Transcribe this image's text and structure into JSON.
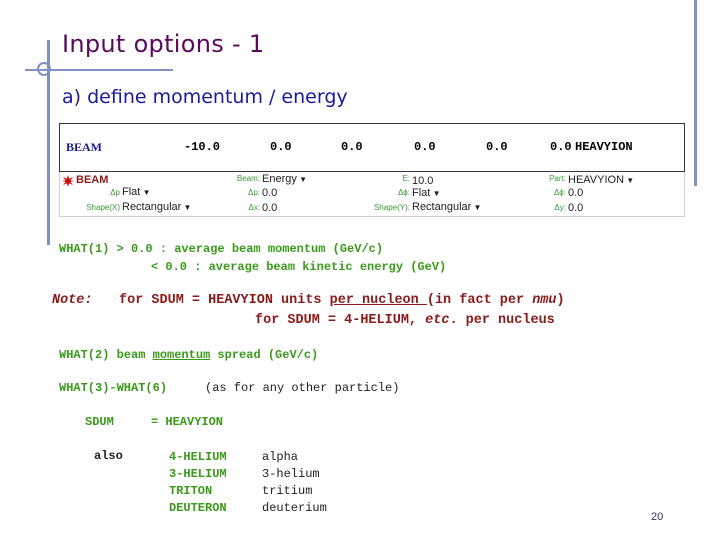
{
  "slide": {
    "title": "Input options - 1",
    "subtitle": "a) define momentum / energy",
    "page_number": "20"
  },
  "card": {
    "keyword": "BEAM",
    "what1": "-10.0",
    "what2": "0.0",
    "what3": "0.0",
    "what4": "0.0",
    "what5": "0.0",
    "what6": "0.0",
    "sdum": "HEAVYION"
  },
  "gui": {
    "header": "BEAM",
    "fields": {
      "beam_label": "Beam:",
      "beam_value": "Energy",
      "e_label": "E:",
      "e_value": "10.0",
      "part_label": "Part:",
      "part_value": "HEAVYION",
      "dp_label": "Δp",
      "dp_value": "Flat",
      "dp_num_label": "Δp:",
      "dp_num_value": "0.0",
      "dphi_label": "Δϕ:",
      "dphi_value": "Flat",
      "dphi_num_label": "Δϕ:",
      "dphi_num_value": "0.0",
      "shapex_label": "Shape(X)",
      "shapex_value": "Rectangular",
      "dx_label": "Δx:",
      "dx_value": "0.0",
      "shapey_label": "Shape(Y):",
      "shapey_value": "Rectangular",
      "dy_label": "Δy:",
      "dy_value": "0.0"
    }
  },
  "body": {
    "what1_line1": "WHAT(1) > 0.0 : average beam momentum (GeV/c)",
    "what1_line2": "< 0.0 : average beam kinetic energy (GeV)",
    "note_label": "Note:",
    "note_line1_a": "for SDUM = HEAVYION units ",
    "note_line1_u": "per nucleon ",
    "note_line1_b": "(in fact per ",
    "note_line1_i": "nmu",
    "note_line1_c": ")",
    "note_line2_a": "for SDUM = 4-HELIUM, ",
    "note_line2_i": "etc",
    "note_line2_b": ". per nucleus",
    "what2_a": "WHAT(2) beam ",
    "what2_u": "momentum",
    "what2_b": " spread (GeV/c)",
    "what36_label": "WHAT(3)-WHAT(6)",
    "what36_text": "(as for any other particle)",
    "sdum_label": "SDUM",
    "sdum_value": "= HEAVYION",
    "also_label": "also",
    "also_items": [
      {
        "code": "4-HELIUM",
        "name": "alpha"
      },
      {
        "code": "3-HELIUM",
        "name": "3-helium"
      },
      {
        "code": "TRITON",
        "name": "tritium"
      },
      {
        "code": "DEUTERON",
        "name": "deuterium"
      }
    ]
  }
}
